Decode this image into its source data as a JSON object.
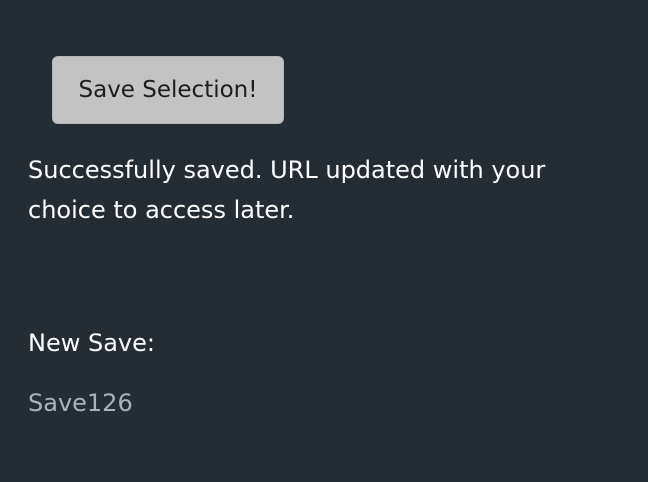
{
  "save_button": {
    "label": "Save Selection!"
  },
  "status": {
    "message": "Successfully saved. URL updated with your choice to access later."
  },
  "new_save": {
    "label": "New Save:",
    "value": "Save126"
  },
  "colors": {
    "background": "#232d33",
    "button_bg": "#c3c3c3",
    "text": "#ffffff",
    "save_value_text": "#a9b4ba"
  }
}
